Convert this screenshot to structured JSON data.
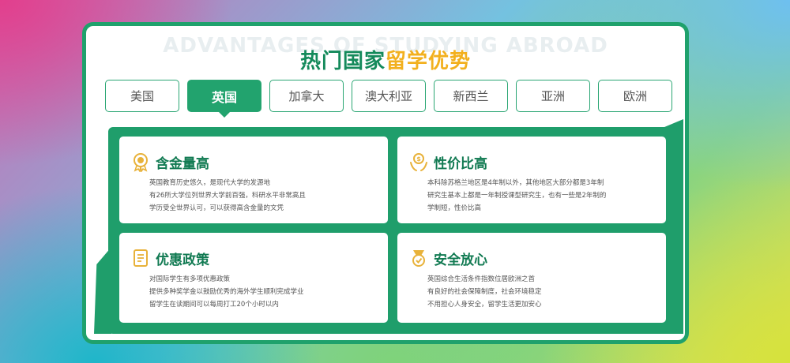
{
  "page": {
    "bg_title": "ADVANTAGES OF STUDYING ABROAD",
    "title_part1": "热门国家",
    "title_part2": "留学优势"
  },
  "tabs": [
    {
      "label": "美国",
      "active": false
    },
    {
      "label": "英国",
      "active": true
    },
    {
      "label": "加拿大",
      "active": false
    },
    {
      "label": "澳大利亚",
      "active": false
    },
    {
      "label": "新西兰",
      "active": false
    },
    {
      "label": "亚洲",
      "active": false
    },
    {
      "label": "欧洲",
      "active": false
    }
  ],
  "cards": [
    {
      "icon": "medal-icon",
      "title": "含金量高",
      "lines": [
        "英国教育历史悠久，是现代大学的发源地",
        "有26所大学位列世界大学前百强，科研水平非常高且",
        "学历受全世界认可，可以获得高含金量的文凭"
      ]
    },
    {
      "icon": "money-hands-icon",
      "title": "性价比高",
      "lines": [
        "本科除苏格兰地区是4年制以外，其他地区大部分都是3年制",
        "研究生基本上都是一年制授课型研究生，也有一些是2年制的",
        "学制短，性价比高"
      ]
    },
    {
      "icon": "document-icon",
      "title": "优惠政策",
      "lines": [
        "对国际学生有多项优惠政策",
        "提供多种奖学金以鼓励优秀的海外学生顺利完成学业",
        "留学生在读期间可以每周打工20个小时以内"
      ]
    },
    {
      "icon": "safety-medal-icon",
      "title": "安全放心",
      "lines": [
        "英国综合生活条件指数位居欧洲之首",
        "有良好的社会保障制度，社会环境稳定",
        "不用担心人身安全，留学生活更加安心"
      ]
    }
  ],
  "colors": {
    "primary_green": "#1fa16c",
    "title_green": "#148a5b",
    "title_gold": "#f2b01e",
    "icon_gold": "#e8b23a"
  }
}
